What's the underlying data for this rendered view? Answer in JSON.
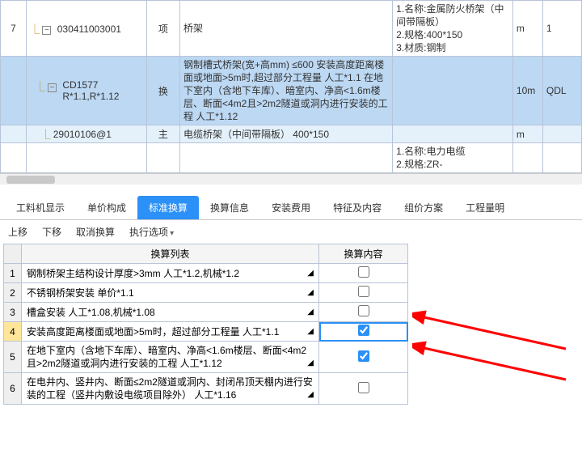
{
  "upper": {
    "rows": [
      {
        "idx": "7",
        "code": "030411003001",
        "unit": "项",
        "desc": "桥架",
        "spec": "1.名称:金属防火桥架（中间带隔板）\n2.规格:400*150\n3.材质:钢制",
        "u": "m",
        "q": "1",
        "cls": "row-white",
        "toggle": "−"
      },
      {
        "idx": "",
        "code": "CD1577\nR*1.1,R*1.12",
        "unit": "换",
        "desc": "钢制槽式桥架(宽+高mm) ≤600 安装高度距离楼面或地面>5m时,超过部分工程量 人工*1.1  在地下室内（含地下车库）、暗室内、净高<1.6m楼层、断面<4m2且>2m2隧道或洞内进行安装的工程 人工*1.12",
        "spec": "",
        "u": "10m",
        "q": "QDL",
        "cls": "row-blue",
        "toggle": "−"
      },
      {
        "idx": "",
        "code": "29010106@1",
        "unit": "主",
        "desc": "电缆桥架（中间带隔板） 400*150",
        "spec": "",
        "u": "m",
        "q": "",
        "cls": "row-cyan",
        "purple": true,
        "red": true
      },
      {
        "idx": "",
        "code": "",
        "unit": "",
        "desc": "",
        "spec": "1.名称:电力电缆\n2.规格:ZR-",
        "u": "",
        "q": "",
        "cls": "row-white"
      }
    ]
  },
  "tabs": {
    "items": [
      {
        "label": "工料机显示"
      },
      {
        "label": "单价构成"
      },
      {
        "label": "标准换算",
        "active": true
      },
      {
        "label": "换算信息"
      },
      {
        "label": "安装费用"
      },
      {
        "label": "特征及内容"
      },
      {
        "label": "组价方案"
      },
      {
        "label": "工程量明"
      }
    ]
  },
  "toolbar": {
    "up": "上移",
    "down": "下移",
    "cancel": "取消换算",
    "exec": "执行选项"
  },
  "lower": {
    "headers": {
      "list": "换算列表",
      "content": "换算内容"
    },
    "rows": [
      {
        "n": "1",
        "text": "钢制桥架主结构设计厚度>3mm 人工*1.2,机械*1.2",
        "chk": false
      },
      {
        "n": "2",
        "text": "不锈钢桥架安装 单价*1.1",
        "chk": false
      },
      {
        "n": "3",
        "text": "槽盒安装 人工*1.08,机械*1.08",
        "chk": false
      },
      {
        "n": "4",
        "text": "安装高度距离楼面或地面>5m时，超过部分工程量 人工*1.1",
        "chk": true,
        "sel": true
      },
      {
        "n": "5",
        "text": "在地下室内（含地下车库）、暗室内、净高<1.6m楼层、断面<4m2且>2m2隧道或洞内进行安装的工程 人工*1.12",
        "chk": true
      },
      {
        "n": "6",
        "text": "在电井内、竖井内、断面≤2m2隧道或洞内、封闭吊顶天棚内进行安装的工程（竖井内敷设电缆项目除外） 人工*1.16",
        "chk": false
      }
    ]
  }
}
